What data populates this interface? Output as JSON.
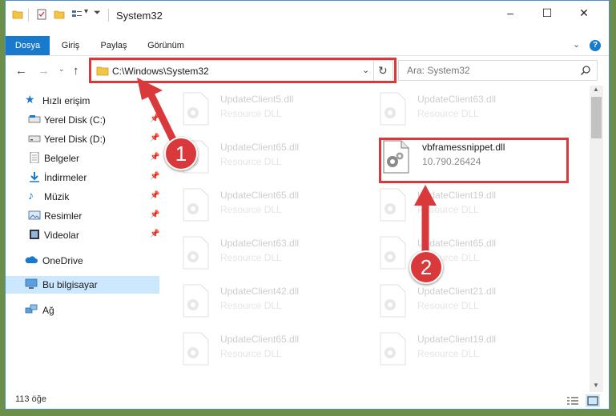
{
  "window": {
    "title": "System32",
    "accent_color": "#1979ca",
    "controls": {
      "minimize": "–",
      "maximize": "☐",
      "close": "✕"
    }
  },
  "ribbon": {
    "tabs": [
      {
        "label": "Dosya"
      },
      {
        "label": "Giriş"
      },
      {
        "label": "Paylaş"
      },
      {
        "label": "Görünüm"
      }
    ],
    "help": "?"
  },
  "navigation": {
    "address_path": "C:\\Windows\\System32",
    "search_placeholder": "Ara: System32"
  },
  "sidebar": {
    "items": [
      {
        "label": "Hızlı erişim",
        "icon": "star-icon"
      },
      {
        "label": "Yerel Disk (C:)",
        "icon": "drive-icon",
        "pinned": true
      },
      {
        "label": "Yerel Disk (D:)",
        "icon": "drive-icon",
        "pinned": true
      },
      {
        "label": "Belgeler",
        "icon": "documents-icon",
        "pinned": true
      },
      {
        "label": "İndirmeler",
        "icon": "download-icon",
        "pinned": true
      },
      {
        "label": "Müzik",
        "icon": "music-icon",
        "pinned": true
      },
      {
        "label": "Resimler",
        "icon": "pictures-icon",
        "pinned": true
      },
      {
        "label": "Videolar",
        "icon": "video-icon",
        "pinned": true
      },
      {
        "label": "OneDrive",
        "icon": "cloud-icon"
      },
      {
        "label": "Bu bilgisayar",
        "icon": "computer-icon",
        "selected": true
      },
      {
        "label": "Ağ",
        "icon": "network-icon"
      }
    ]
  },
  "files": {
    "left_column": [
      {
        "name": "UpdateClient5.dll",
        "desc": "Resource DLL"
      },
      {
        "name": "UpdateClient65.dll",
        "desc": "Resource DLL"
      },
      {
        "name": "UpdateClient65.dll",
        "desc": "Resource DLL"
      },
      {
        "name": "UpdateClient63.dll",
        "desc": "Resource DLL"
      },
      {
        "name": "UpdateClient42.dll",
        "desc": "Resource DLL"
      },
      {
        "name": "UpdateClient65.dll",
        "desc": "Resource DLL"
      }
    ],
    "right_column": [
      {
        "name": "UpdateClient63.dll",
        "desc": "Resource DLL"
      },
      {
        "name": "vbframessnippet.dll",
        "desc": "10.790.26424",
        "highlighted": true
      },
      {
        "name": "UpdateClient19.dll",
        "desc": "Resource DLL"
      },
      {
        "name": "UpdateClient65.dll",
        "desc": "Resource DLL"
      },
      {
        "name": "UpdateClient21.dll",
        "desc": "Resource DLL"
      },
      {
        "name": "UpdateClient19.dll",
        "desc": "Resource DLL"
      }
    ]
  },
  "status": {
    "item_count": "113 öğe"
  },
  "annotations": {
    "badge_1": "1",
    "badge_2": "2",
    "color": "#d9393b"
  }
}
